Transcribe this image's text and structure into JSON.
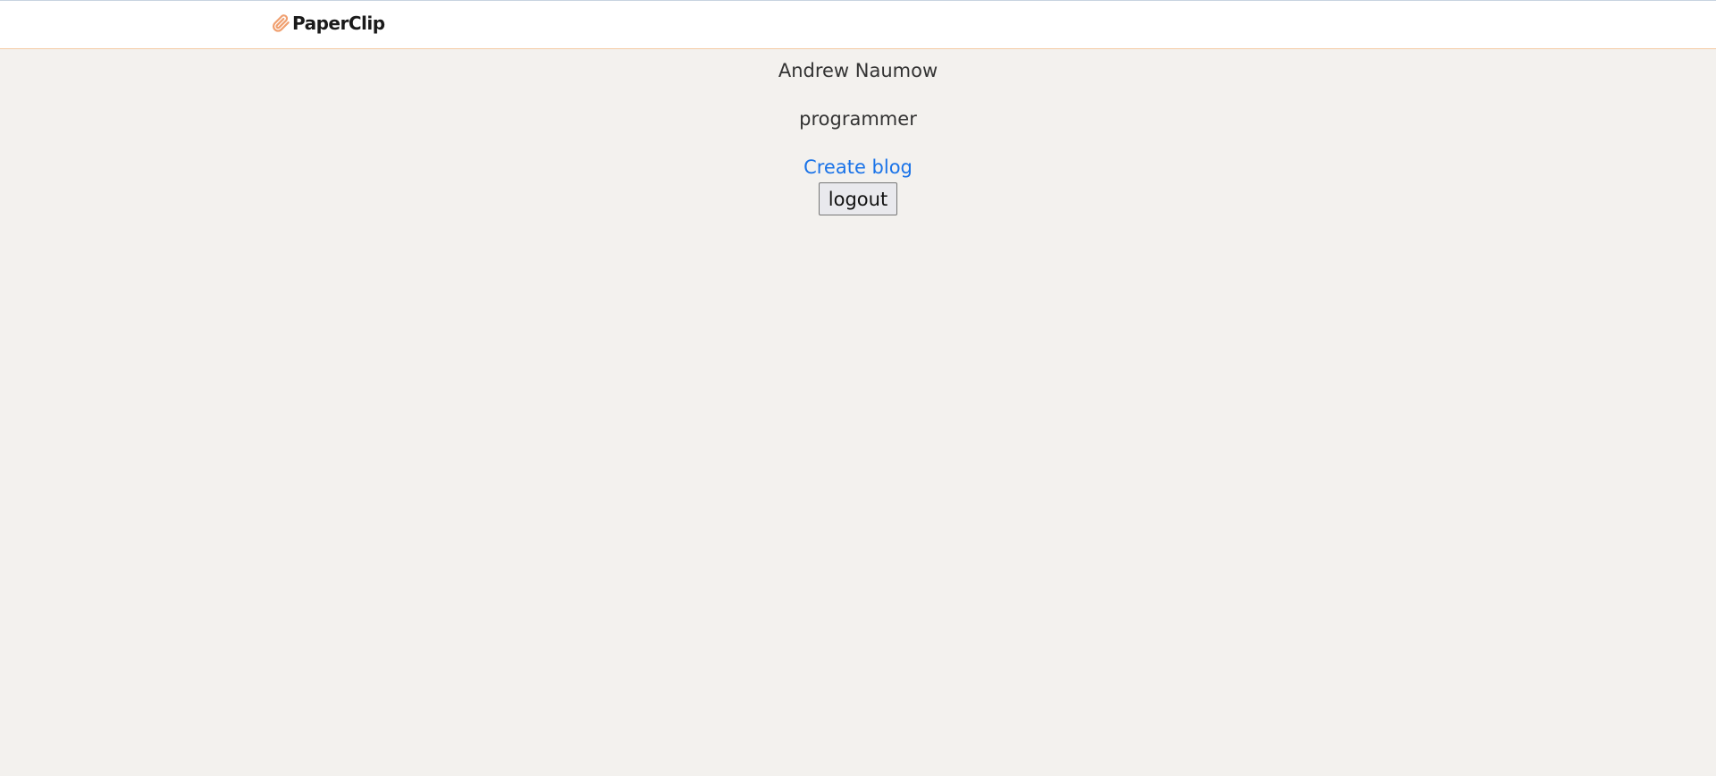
{
  "header": {
    "brand": "PaperClip",
    "brand_icon": "paperclip-icon",
    "brand_icon_color": "#f0a070"
  },
  "profile": {
    "name": "Andrew Naumow",
    "role": "programmer",
    "create_blog_label": "Create blog",
    "logout_label": "logout"
  },
  "colors": {
    "background": "#f3f1ee",
    "link": "#1a73e8",
    "accent": "#f0a070"
  }
}
